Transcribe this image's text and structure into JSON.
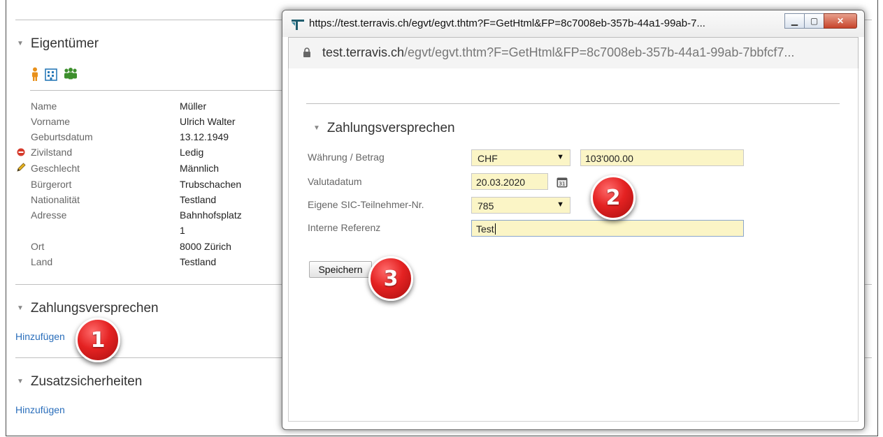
{
  "background": {
    "owner_section": {
      "title": "Eigentümer",
      "icons": [
        "person-icon",
        "building-icon",
        "group-icon"
      ],
      "fields": [
        {
          "label": "Name",
          "value": "Müller"
        },
        {
          "label": "Vorname",
          "value": "Ulrich Walter"
        },
        {
          "label": "Geburtsdatum",
          "value": "13.12.1949"
        },
        {
          "label": "Zivilstand",
          "value": "Ledig",
          "indicator": "minus-circle-icon"
        },
        {
          "label": "Geschlecht",
          "value": "Männlich",
          "indicator": "pencil-icon"
        },
        {
          "label": "Bürgerort",
          "value": "Trubschachen"
        },
        {
          "label": "Nationalität",
          "value": "Testland"
        },
        {
          "label": "Adresse",
          "value": "Bahnhofsplatz"
        },
        {
          "label": "",
          "value": "1"
        },
        {
          "label": "Ort",
          "value": "8000 Zürich"
        },
        {
          "label": "Land",
          "value": "Testland"
        }
      ]
    },
    "payment_section": {
      "title": "Zahlungsversprechen",
      "add_link": "Hinzufügen"
    },
    "additional_section": {
      "title": "Zusatzsicherheiten",
      "add_link": "Hinzufügen"
    }
  },
  "popup": {
    "window_title": "https://test.terravis.ch/egvt/egvt.thtm?F=GetHtml&FP=8c7008eb-357b-44a1-99ab-7...",
    "address": {
      "domain": "test.terravis.ch",
      "path": "/egvt/egvt.thtm?F=GetHtml&FP=8c7008eb-357b-44a1-99ab-7bbfcf7..."
    },
    "section_title": "Zahlungsversprechen",
    "form": {
      "currency_label": "Währung / Betrag",
      "currency_value": "CHF",
      "amount_value": "103'000.00",
      "value_date_label": "Valutadatum",
      "value_date": "20.03.2020",
      "calendar_day": "31",
      "sic_label": "Eigene SIC-Teilnehmer-Nr.",
      "sic_value": "785",
      "reference_label": "Interne Referenz",
      "reference_value": "Test"
    },
    "save_button": "Speichern"
  },
  "step_badges": [
    "1",
    "2",
    "3"
  ],
  "colors": {
    "link": "#2a6ebb",
    "field_bg": "#fbf5c6",
    "badge": "#e42222"
  }
}
